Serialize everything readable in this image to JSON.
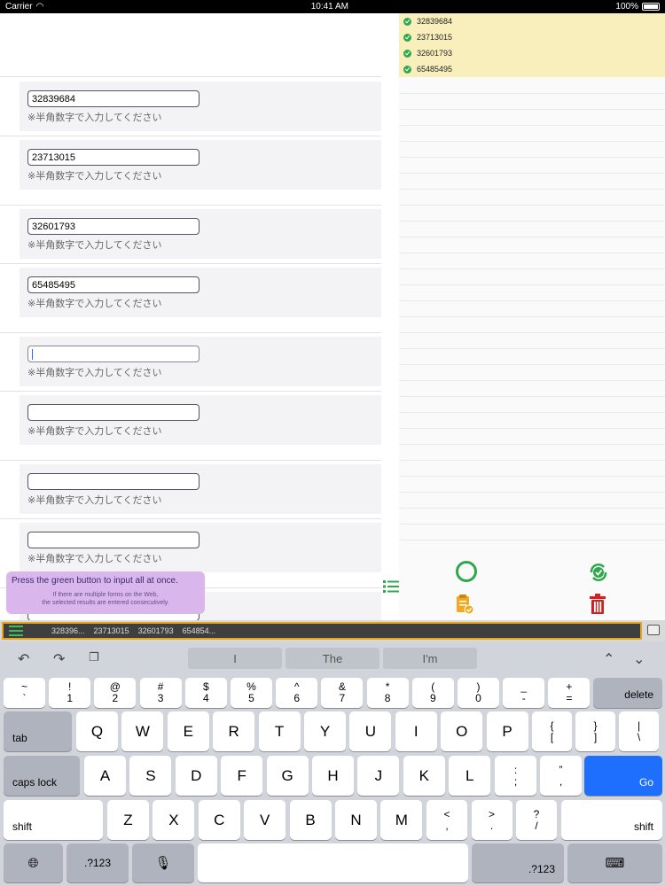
{
  "status_bar": {
    "carrier": "Carrier",
    "time": "10:41 AM",
    "battery": "100%"
  },
  "form": {
    "hint": "※半角数字で入力してください",
    "fields": [
      "32839684",
      "23713015",
      "32601793",
      "65485495",
      "",
      "",
      "",
      ""
    ]
  },
  "selected_values": [
    "32839684",
    "23713015",
    "32601793",
    "65485495"
  ],
  "tooltip": {
    "title": "Press the green button to input all at once.",
    "line1": "If there are multiple forms on the Web,",
    "line2": "the selected results are entered consecutively."
  },
  "suggestion_bar": {
    "chips": [
      "328396...",
      "23713015",
      "32601793",
      "654854..."
    ]
  },
  "keyboard": {
    "suggestions": [
      "I",
      "The",
      "I'm"
    ],
    "delete": "delete",
    "tab": "tab",
    "caps_lock": "caps lock",
    "go": "Go",
    "shift": "shift",
    "numbers": ".?123",
    "row1": [
      [
        "~",
        "`"
      ],
      [
        "!",
        "1"
      ],
      [
        "@",
        "2"
      ],
      [
        "#",
        "3"
      ],
      [
        "$",
        "4"
      ],
      [
        "%",
        "5"
      ],
      [
        "^",
        "6"
      ],
      [
        "&",
        "7"
      ],
      [
        "*",
        "8"
      ],
      [
        "(",
        "9"
      ],
      [
        ")",
        "0"
      ],
      [
        "_",
        "-"
      ],
      [
        "+",
        "="
      ]
    ],
    "row2": [
      "Q",
      "W",
      "E",
      "R",
      "T",
      "Y",
      "U",
      "I",
      "O",
      "P"
    ],
    "row2_sym": [
      [
        "{",
        "["
      ],
      [
        "}",
        "]"
      ],
      [
        "|",
        "\\"
      ]
    ],
    "row3": [
      "A",
      "S",
      "D",
      "F",
      "G",
      "H",
      "J",
      "K",
      "L"
    ],
    "row3_sym": [
      [
        ":",
        ";"
      ],
      [
        "”",
        ","
      ]
    ],
    "row4": [
      "Z",
      "X",
      "C",
      "V",
      "B",
      "N",
      "M"
    ],
    "row4_sym": [
      [
        "<",
        ","
      ],
      [
        ">",
        "."
      ],
      [
        "?",
        "/"
      ]
    ]
  },
  "colors": {
    "accent_green": "#2ea84a",
    "go_blue": "#1f6fff",
    "trash_red": "#d32020",
    "highlight_yellow": "#f8efbd",
    "tooltip_purple": "#d9b6ec"
  }
}
